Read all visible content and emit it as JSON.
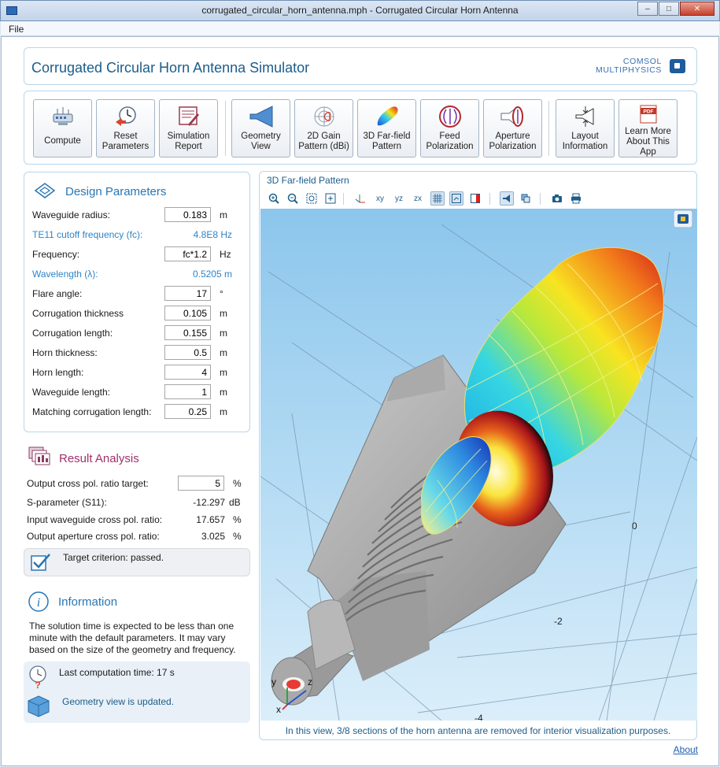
{
  "window": {
    "title": "corrugated_circular_horn_antenna.mph - Corrugated Circular Horn Antenna"
  },
  "menu": {
    "file": "File"
  },
  "header": {
    "app_title": "Corrugated Circular Horn Antenna Simulator",
    "logo_line1": "COMSOL",
    "logo_line2": "MULTIPHYSICS"
  },
  "toolbar": {
    "compute": "Compute",
    "reset": "Reset\nParameters",
    "report": "Simulation\nReport",
    "geometry": "Geometry\nView",
    "gain2d": "2D Gain\nPattern (dBi)",
    "farfield3d": "3D Far-field\nPattern",
    "feed": "Feed\nPolarization",
    "aperture": "Aperture\nPolarization",
    "layout": "Layout\nInformation",
    "learn": "Learn More\nAbout This\nApp",
    "pdf_badge": "PDF"
  },
  "design": {
    "title": "Design Parameters",
    "rows": [
      {
        "label": "Waveguide radius:",
        "value": "0.183",
        "unit": "m"
      },
      {
        "label": "TE11 cutoff frequency (fc):",
        "value": "4.8E8 Hz"
      },
      {
        "label": "Frequency:",
        "value": "fc*1.2",
        "unit": "Hz"
      },
      {
        "label": "Wavelength (λ):",
        "value": "0.5205 m"
      },
      {
        "label": "Flare angle:",
        "value": "17",
        "unit": "°"
      },
      {
        "label": "Corrugation thickness",
        "value": "0.105",
        "unit": "m"
      },
      {
        "label": "Corrugation length:",
        "value": "0.155",
        "unit": "m"
      },
      {
        "label": "Horn thickness:",
        "value": "0.5",
        "unit": "m"
      },
      {
        "label": "Horn length:",
        "value": "4",
        "unit": "m"
      },
      {
        "label": "Waveguide length:",
        "value": "1",
        "unit": "m"
      },
      {
        "label": "Matching corrugation length:",
        "value": "0.25",
        "unit": "m"
      }
    ]
  },
  "result": {
    "title": "Result Analysis",
    "target_label": "Output cross pol. ratio target:",
    "target_value": "5",
    "target_unit": "%",
    "rows": [
      {
        "label": "S-parameter (S11):",
        "value": "-12.297",
        "unit": "dB"
      },
      {
        "label": "Input waveguide cross pol. ratio:",
        "value": "17.657",
        "unit": "%"
      },
      {
        "label": "Output aperture cross pol. ratio:",
        "value": "3.025",
        "unit": "%"
      }
    ],
    "criterion": "Target criterion: passed."
  },
  "info": {
    "title": "Information",
    "text": "The solution time is expected to be less than one minute with the default parameters. It may vary based on the size of the geometry and frequency.",
    "last_time": "Last computation time: 17 s",
    "geom_status": "Geometry view is updated."
  },
  "view": {
    "title": "3D Far-field Pattern",
    "tools": [
      "zoom-in-icon",
      "zoom-out-icon",
      "zoom-box-icon",
      "zoom-extents-icon",
      "axis-icon",
      "xy-view-icon",
      "yz-view-icon",
      "zx-view-icon",
      "grid-icon",
      "axes-toggle-icon",
      "legend-icon",
      "render-icon",
      "transparency-icon",
      "camera-icon",
      "print-icon"
    ],
    "tool_text": {
      "xy": "xy",
      "yz": "yz",
      "zx": "zx"
    },
    "axis_ticks": [
      "0",
      "-2",
      "-4"
    ],
    "triad": {
      "x": "x",
      "y": "y",
      "z": "z"
    },
    "caption": "In this view, 3/8 sections of the horn antenna are removed for interior visualization purposes."
  },
  "footer": {
    "about": "About"
  }
}
